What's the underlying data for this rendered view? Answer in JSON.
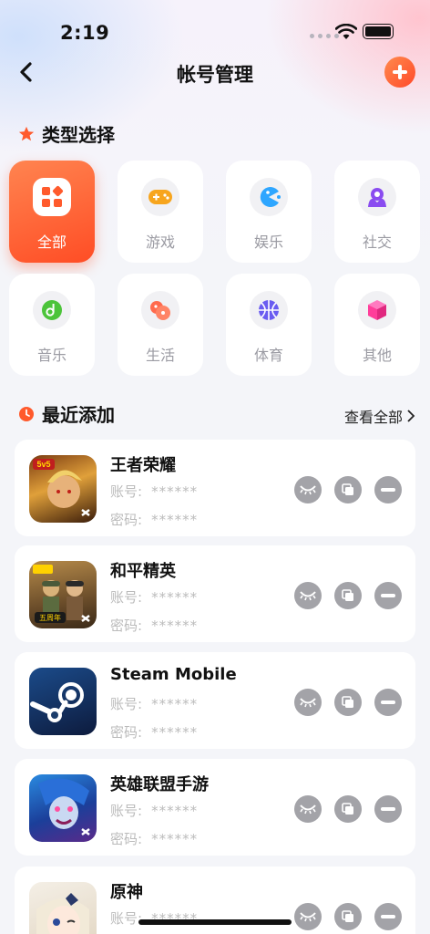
{
  "status": {
    "time": "2:19"
  },
  "nav": {
    "title": "帐号管理"
  },
  "sections": {
    "type_title": "类型选择",
    "recent_title": "最近添加",
    "view_all": "查看全部"
  },
  "categories": [
    {
      "label": "全部",
      "icon": "grid-icon",
      "active": true
    },
    {
      "label": "游戏",
      "icon": "gamepad-icon",
      "color": "#f7a51d"
    },
    {
      "label": "娱乐",
      "icon": "pacman-icon",
      "color": "#2ea6ff"
    },
    {
      "label": "社交",
      "icon": "social-icon",
      "color": "#8a4cf0"
    },
    {
      "label": "音乐",
      "icon": "music-icon",
      "color": "#4cc43a"
    },
    {
      "label": "生活",
      "icon": "life-icon",
      "color": "#ff6a4d"
    },
    {
      "label": "体育",
      "icon": "basketball-icon",
      "color": "#6a5cf0"
    },
    {
      "label": "其他",
      "icon": "cube-icon",
      "color": "#ff3d9a"
    }
  ],
  "fields": {
    "account_label": "账号:",
    "password_label": "密码:"
  },
  "accounts": [
    {
      "name": "王者荣耀",
      "account": "******",
      "password": "******",
      "badge": "5v5"
    },
    {
      "name": "和平精英",
      "account": "******",
      "password": "******",
      "badge": "五周年"
    },
    {
      "name": "Steam Mobile",
      "account": "******",
      "password": "******"
    },
    {
      "name": "英雄联盟手游",
      "account": "******",
      "password": "******"
    },
    {
      "name": "原神",
      "account": "******",
      "password": "******"
    }
  ]
}
